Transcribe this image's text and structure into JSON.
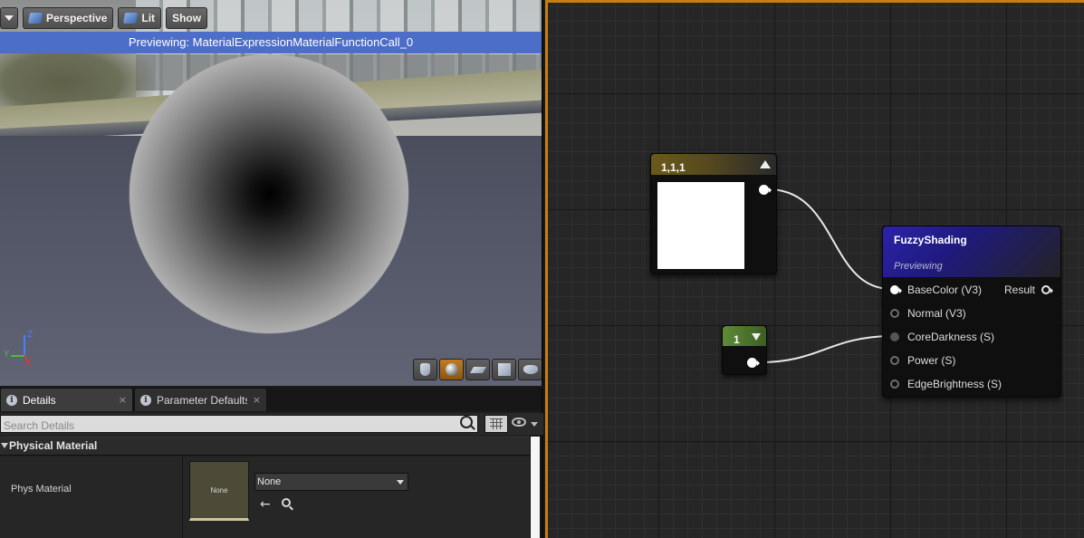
{
  "viewport": {
    "toolbar": {
      "perspective_label": "Perspective",
      "lit_label": "Lit",
      "show_label": "Show"
    },
    "preview_banner": "Previewing: MaterialExpressionMaterialFunctionCall_0",
    "axes": {
      "z": "Z",
      "y": "Y",
      "x": "X"
    },
    "shape_buttons": [
      "cylinder",
      "sphere",
      "plane",
      "cube",
      "custom-mesh"
    ],
    "active_shape": "sphere"
  },
  "details_panel": {
    "tabs": [
      {
        "label": "Details",
        "close": "×"
      },
      {
        "label": "Parameter Defaults",
        "close": "×"
      }
    ],
    "search_placeholder": "Search Details",
    "category": "Physical Material",
    "property": {
      "name": "Phys Material",
      "thumbnail_text": "None",
      "value": "None"
    }
  },
  "graph": {
    "constant3_node": {
      "title": "1,1,1",
      "color": "#ffffff"
    },
    "constant_node": {
      "title": "1"
    },
    "function_node": {
      "title": "FuzzyShading",
      "subtitle": "Previewing",
      "inputs": [
        "BaseColor (V3)",
        "Normal (V3)",
        "CoreDarkness (S)",
        "Power (S)",
        "EdgeBrightness (S)"
      ],
      "output": "Result"
    },
    "accent_color": "#c87d12"
  }
}
